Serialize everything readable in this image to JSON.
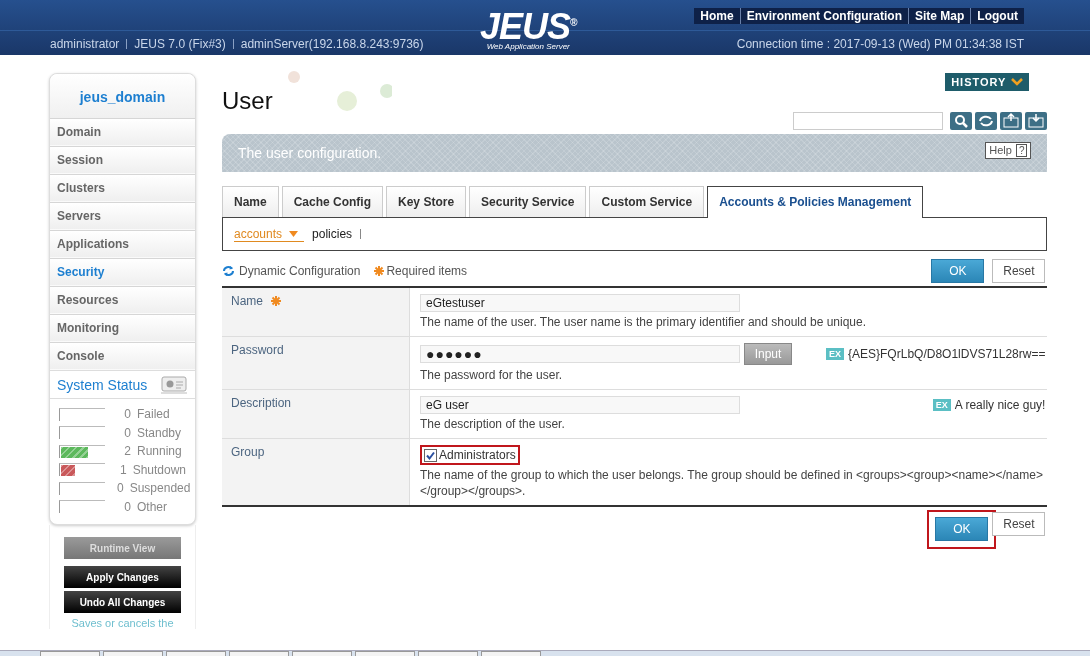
{
  "header": {
    "nav": [
      "Home",
      "Environment Configuration",
      "Site Map",
      "Logout"
    ],
    "logo": "JEUS$^{®}$",
    "logo_subtitle": "Web Application Server",
    "user": "administrator",
    "version": "JEUS 7.0 (Fix#3)",
    "server": "adminServer(192.168.8.243:9736)",
    "connection_time": "Connection time : 2017-09-13 (Wed) PM 01:34:38 IST"
  },
  "sidebar": {
    "domain": "jeus_domain",
    "items": [
      {
        "label": "Domain",
        "selected": false
      },
      {
        "label": "Session",
        "selected": false
      },
      {
        "label": "Clusters",
        "selected": false
      },
      {
        "label": "Servers",
        "selected": false
      },
      {
        "label": "Applications",
        "selected": false
      },
      {
        "label": "Security",
        "selected": true
      },
      {
        "label": "Resources",
        "selected": false
      },
      {
        "label": "Monitoring",
        "selected": false
      },
      {
        "label": "Console",
        "selected": false
      }
    ],
    "system_status": {
      "title": "System Status",
      "items": [
        {
          "count": "0",
          "label": "Failed"
        },
        {
          "count": "0",
          "label": "Standby"
        },
        {
          "count": "2",
          "label": "Running",
          "level": 0.6,
          "color": "#5cb85c"
        },
        {
          "count": "1",
          "label": "Shutdown",
          "level": 0.3,
          "color": "#c9585a"
        },
        {
          "count": "0",
          "label": "Suspended"
        },
        {
          "count": "0",
          "label": "Other"
        }
      ]
    },
    "buttons": [
      {
        "label": "Runtime View",
        "kind": "runtime"
      },
      {
        "label": "Apply Changes",
        "kind": "apply"
      },
      {
        "label": "Undo All Changes",
        "kind": "apply"
      }
    ],
    "note": "Saves or cancels the"
  },
  "main": {
    "title": "User",
    "history": "HISTORY",
    "description": "The user configuration.",
    "help": {
      "label": "Help",
      "icon": "?"
    },
    "tabs": [
      {
        "label": "Name",
        "selected": false
      },
      {
        "label": "Cache Config",
        "selected": false
      },
      {
        "label": "Key Store",
        "selected": false
      },
      {
        "label": "Security Service",
        "selected": false
      },
      {
        "label": "Custom Service",
        "selected": false
      },
      {
        "label": "Accounts & Policies Management",
        "selected": true
      }
    ],
    "subtabs": [
      {
        "label": "accounts",
        "selected": true
      },
      {
        "label": "policies",
        "selected": false
      }
    ],
    "legend": {
      "dynamic": "Dynamic Configuration",
      "required": "Required items"
    },
    "top_buttons": [
      {
        "label": "OK",
        "kind": "primary"
      },
      {
        "label": "Reset",
        "kind": "secondary"
      }
    ],
    "fields": [
      {
        "label": "Name",
        "required": true,
        "kind": "text",
        "value": "eGtestuser",
        "description": "The name of the user. The user name is the primary identifier and should be unique."
      },
      {
        "label": "Password",
        "kind": "password",
        "value": "●●●●●●",
        "button": "Input",
        "example_badge": "EX",
        "example": "{AES}FQrLbQ/D8O1lDVS71L28rw==",
        "description": "The password for the user."
      },
      {
        "label": "Description",
        "kind": "text",
        "value": "eG user",
        "example_badge": "EX",
        "example": "A really nice guy!",
        "description": "The description of the user."
      },
      {
        "label": "Group",
        "kind": "checkbox",
        "options": [
          {
            "label": "Administrators",
            "checked": true,
            "highlighted": true
          }
        ],
        "description": "The name of the group to which the user belongs. The group should be defined in <groups><group><name></name></group></groups>."
      }
    ],
    "bottom_buttons": [
      {
        "label": "OK",
        "kind": "primary",
        "highlighted": true
      },
      {
        "label": "Reset",
        "kind": "secondary",
        "highlighted": false
      }
    ]
  }
}
